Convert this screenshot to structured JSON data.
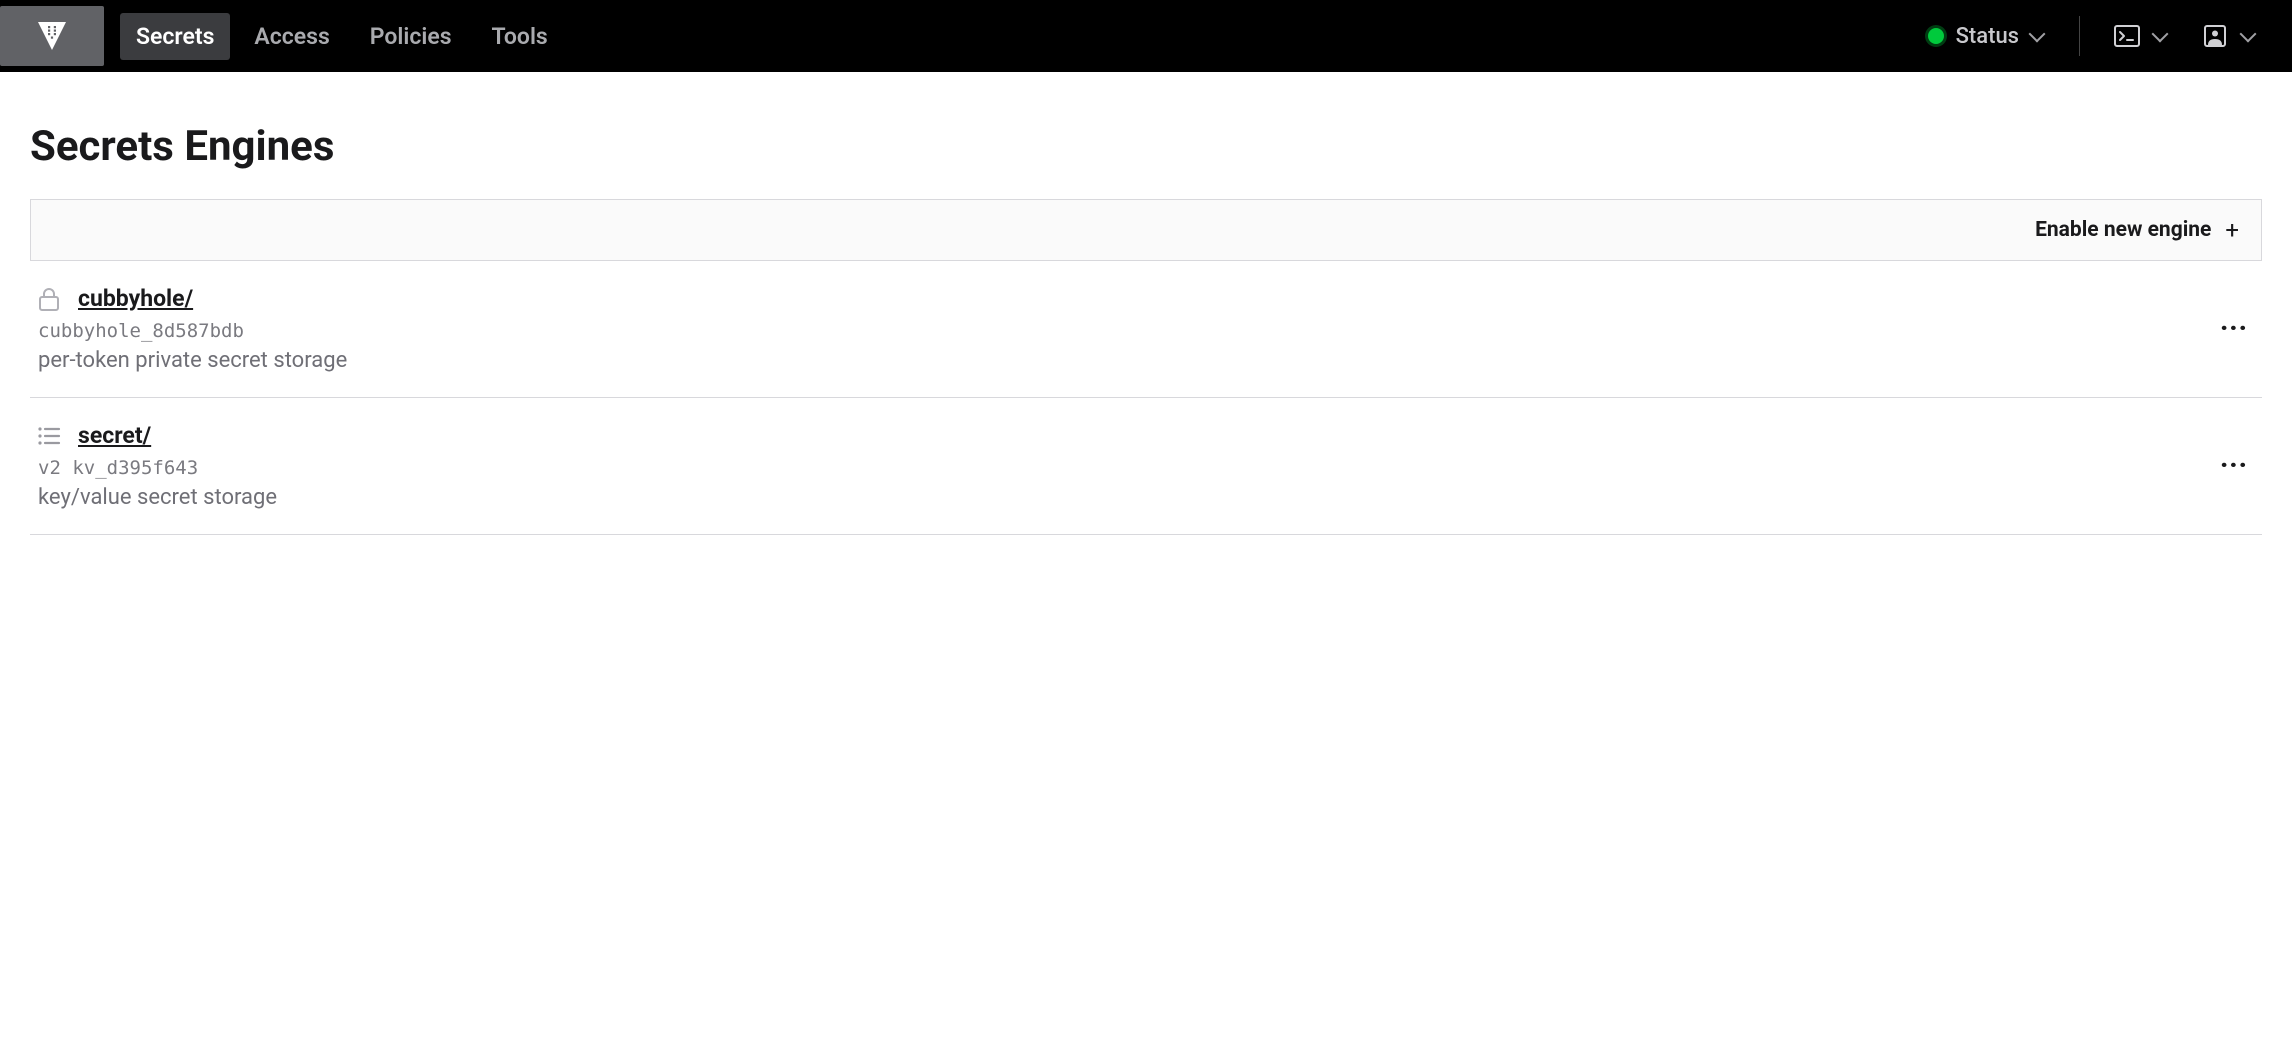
{
  "nav": {
    "items": [
      {
        "label": "Secrets",
        "active": true
      },
      {
        "label": "Access",
        "active": false
      },
      {
        "label": "Policies",
        "active": false
      },
      {
        "label": "Tools",
        "active": false
      }
    ],
    "status_label": "Status",
    "status_color": "#00ca3c"
  },
  "page": {
    "title": "Secrets Engines",
    "enable_label": "Enable new engine"
  },
  "engines": [
    {
      "icon": "lock",
      "name": "cubbyhole/",
      "id": "cubbyhole_8d587bdb",
      "description": "per-token private secret storage"
    },
    {
      "icon": "list",
      "name": "secret/",
      "id": "v2 kv_d395f643",
      "description": "key/value secret storage"
    }
  ]
}
